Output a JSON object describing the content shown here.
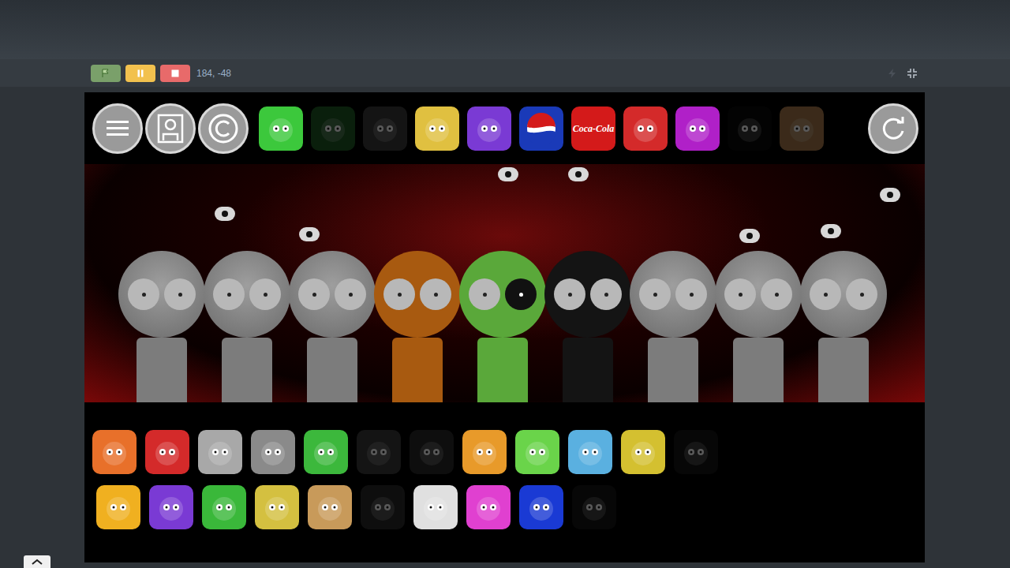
{
  "controls": [
    {
      "kind": "flag",
      "color": "#7aa06a"
    },
    {
      "kind": "pause",
      "color": "#f2c14e"
    },
    {
      "kind": "stop",
      "color": "#e86a6a"
    }
  ],
  "coordinates": "184, -48",
  "top_icons": [
    {
      "color": "#3cc83c",
      "dimmed": false,
      "label": ""
    },
    {
      "color": "#1f5a24",
      "dimmed": true,
      "label": ""
    },
    {
      "color": "#3a3a3a",
      "dimmed": true,
      "label": ""
    },
    {
      "color": "#e0c040",
      "dimmed": false,
      "label": ""
    },
    {
      "color": "#7a3ad4",
      "dimmed": false,
      "label": ""
    },
    {
      "color": "#1a3ab8",
      "dimmed": false,
      "label": ""
    },
    {
      "color": "#d41a1a",
      "dimmed": false,
      "label": "Coca-Cola"
    },
    {
      "color": "#d42a2a",
      "dimmed": false,
      "label": ""
    },
    {
      "color": "#b020c8",
      "dimmed": false,
      "label": ""
    },
    {
      "color": "#0a0a0a",
      "dimmed": true,
      "label": ""
    },
    {
      "color": "#a87a4a",
      "dimmed": true,
      "label": ""
    }
  ],
  "stage_slots": [
    {
      "filled": false,
      "color": "#9a9a9a"
    },
    {
      "filled": false,
      "color": "#9a9a9a"
    },
    {
      "filled": false,
      "color": "#9a9a9a"
    },
    {
      "filled": true,
      "color": "#a85a10"
    },
    {
      "filled": true,
      "color": "#5aa83a"
    },
    {
      "filled": true,
      "color": "#141414"
    },
    {
      "filled": false,
      "color": "#9a9a9a"
    },
    {
      "filled": false,
      "color": "#9a9a9a"
    },
    {
      "filled": false,
      "color": "#9a9a9a"
    }
  ],
  "bottom_rows": [
    [
      {
        "color": "#e8702a",
        "dimmed": false
      },
      {
        "color": "#d42a2a",
        "dimmed": false
      },
      {
        "color": "#a8a8a8",
        "dimmed": false
      },
      {
        "color": "#8a8a8a",
        "dimmed": false
      },
      {
        "color": "#3cb83c",
        "dimmed": false
      },
      {
        "color": "#3a3a3a",
        "dimmed": true
      },
      {
        "color": "#2a2a2a",
        "dimmed": true
      },
      {
        "color": "#e89a2a",
        "dimmed": false
      },
      {
        "color": "#6ad44a",
        "dimmed": false
      },
      {
        "color": "#5ab0e0",
        "dimmed": false
      },
      {
        "color": "#d4c030",
        "dimmed": false
      },
      {
        "color": "#151515",
        "dimmed": true
      }
    ],
    [
      {
        "color": "#f0b020",
        "dimmed": false
      },
      {
        "color": "#7a3ad4",
        "dimmed": false
      },
      {
        "color": "#3ab83a",
        "dimmed": false
      },
      {
        "color": "#d4c040",
        "dimmed": false
      },
      {
        "color": "#c89a5a",
        "dimmed": false
      },
      {
        "color": "#2a2a2a",
        "dimmed": true
      },
      {
        "color": "#e0e0e0",
        "dimmed": false
      },
      {
        "color": "#e040d0",
        "dimmed": false
      },
      {
        "color": "#1a3ad4",
        "dimmed": false
      },
      {
        "color": "#151515",
        "dimmed": true
      }
    ]
  ]
}
